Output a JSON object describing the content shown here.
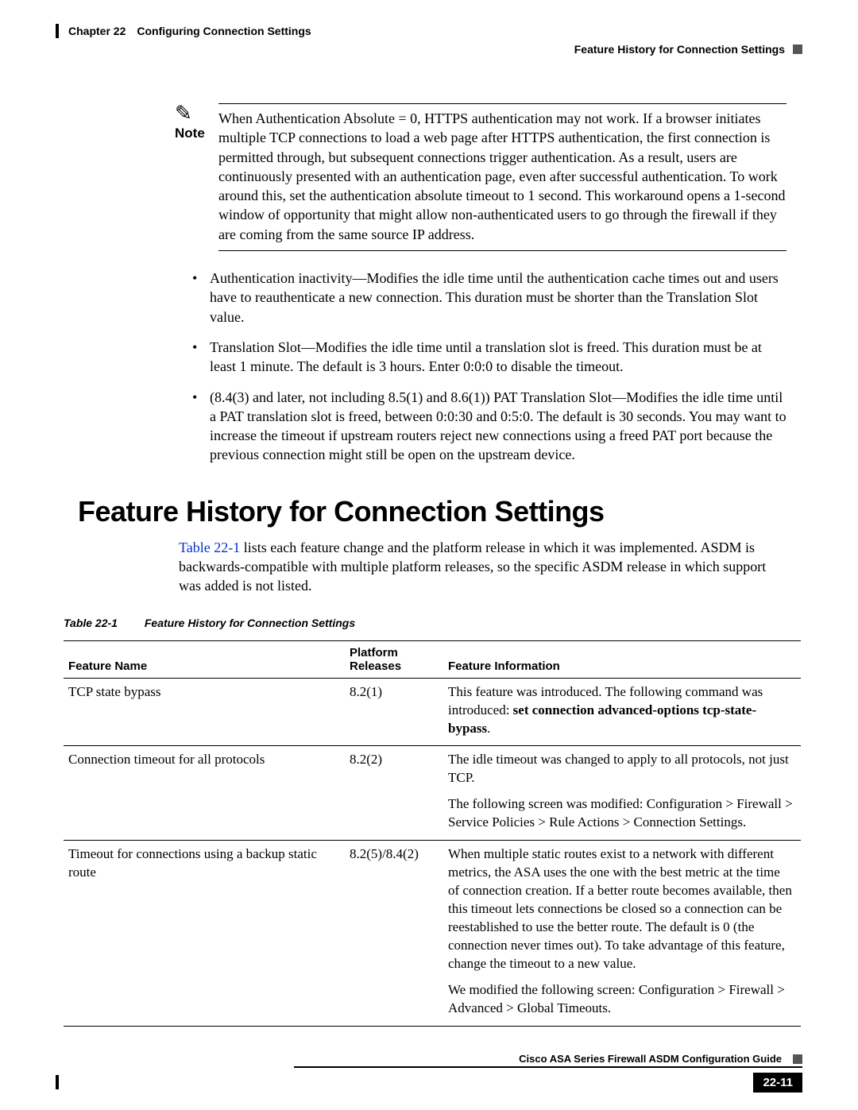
{
  "header": {
    "chapter": "Chapter 22",
    "chapter_title": "Configuring Connection Settings",
    "right_title": "Feature History for Connection Settings"
  },
  "note": {
    "label": "Note",
    "body": "When Authentication Absolute = 0, HTTPS authentication may not work. If a browser initiates multiple TCP connections to load a web page after HTTPS authentication, the first connection is permitted through, but subsequent connections trigger authentication. As a result, users are continuously presented with an authentication page, even after successful authentication. To work around this, set the authentication absolute timeout to 1 second. This workaround opens a 1-second window of opportunity that might allow non-authenticated users to go through the firewall if they are coming from the same source IP address."
  },
  "bullets": [
    "Authentication inactivity—Modifies the idle time until the authentication cache times out and users have to reauthenticate a new connection. This duration must be shorter than the Translation Slot value.",
    "Translation Slot—Modifies the idle time until a translation slot is freed. This duration must be at least 1 minute. The default is 3 hours. Enter 0:0:0 to disable the timeout.",
    "(8.4(3) and later, not including 8.5(1) and 8.6(1)) PAT Translation Slot—Modifies the idle time until a PAT translation slot is freed, between 0:0:30 and 0:5:0. The default is 30 seconds. You may want to increase the timeout if upstream routers reject new connections using a freed PAT port because the previous connection might still be open on the upstream device."
  ],
  "heading": "Feature History for Connection Settings",
  "intro": {
    "link_text": "Table 22-1",
    "rest": " lists each feature change and the platform release in which it was implemented. ASDM is backwards-compatible with multiple platform releases, so the specific ASDM release in which support was added is not listed."
  },
  "table_caption": {
    "number": "Table 22-1",
    "title": "Feature History for Connection Settings"
  },
  "table": {
    "headers": {
      "name": "Feature Name",
      "releases": "Platform Releases",
      "info": "Feature Information"
    },
    "rows": [
      {
        "name": "TCP state bypass",
        "release": "8.2(1)",
        "info_pre": "This feature was introduced. The following command was introduced: ",
        "info_bold": "set connection advanced-options tcp-state-bypass",
        "info_post": ".",
        "info_para2": ""
      },
      {
        "name": "Connection timeout for all protocols",
        "release": "8.2(2)",
        "info_pre": "The idle timeout was changed to apply to all protocols, not just TCP.",
        "info_bold": "",
        "info_post": "",
        "info_para2": "The following screen was modified: Configuration > Firewall > Service Policies > Rule Actions > Connection Settings."
      },
      {
        "name": "Timeout for connections using a backup static route",
        "release": "8.2(5)/8.4(2)",
        "info_pre": "When multiple static routes exist to a network with different metrics, the ASA uses the one with the best metric at the time of connection creation. If a better route becomes available, then this timeout lets connections be closed so a connection can be reestablished to use the better route. The default is 0 (the connection never times out). To take advantage of this feature, change the timeout to a new value.",
        "info_bold": "",
        "info_post": "",
        "info_para2": "We modified the following screen: Configuration > Firewall > Advanced > Global Timeouts."
      }
    ]
  },
  "footer": {
    "guide": "Cisco ASA Series Firewall ASDM Configuration Guide",
    "page": "22-11"
  }
}
